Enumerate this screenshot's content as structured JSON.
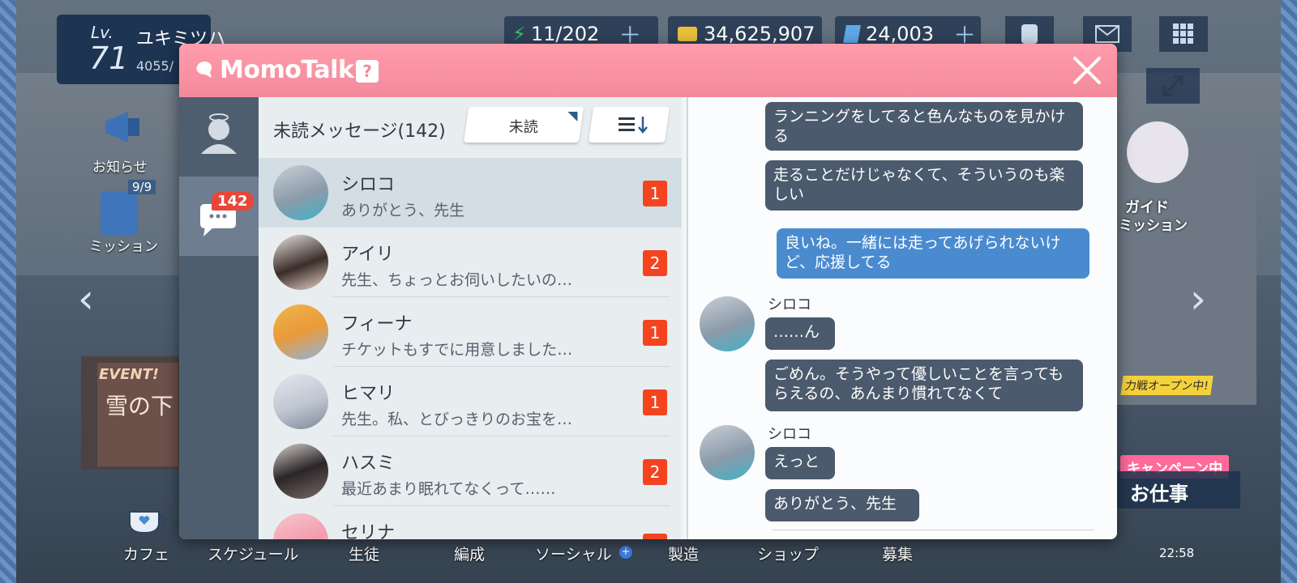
{
  "player": {
    "lv_label": "Lv.",
    "level": "71",
    "name": "ユキミツハ",
    "exp": "4055/"
  },
  "resources": [
    {
      "name": "ap",
      "value": "11/202"
    },
    {
      "name": "credits",
      "value": "34,625,907"
    },
    {
      "name": "pyroxene",
      "value": "24,003"
    }
  ],
  "side_menu": {
    "notice_label": "お知らせ",
    "mission_label": "ミッション",
    "mission_count": "9/9"
  },
  "event_banner": {
    "event_label": "EVENT!",
    "event_title": "雪の下"
  },
  "right_banner": {
    "guide_label": "ガイド",
    "mission_label": "ミッション",
    "campaign_label": "キャンペーン中",
    "work_label": "お仕事",
    "open_label": "力戦オープン中!"
  },
  "bottom_nav": [
    "カフェ",
    "スケジュール",
    "生徒",
    "編成",
    "ソーシャル",
    "製造",
    "ショップ",
    "募集"
  ],
  "clock": "22:58",
  "momotalk": {
    "title": "MomoTalk",
    "help": "?",
    "unread_badge": "142",
    "list_title": "未読メッセージ(142)",
    "filter_label": "未読",
    "conversations": [
      {
        "name": "シロコ",
        "preview": "ありがとう、先生",
        "unread": "1"
      },
      {
        "name": "アイリ",
        "preview": "先生、ちょっとお伺いしたいの…",
        "unread": "2"
      },
      {
        "name": "フィーナ",
        "preview": "チケットもすでに用意しました…",
        "unread": "1"
      },
      {
        "name": "ヒマリ",
        "preview": "先生。私、とびっきりのお宝を…",
        "unread": "1"
      },
      {
        "name": "ハスミ",
        "preview": "最近あまり眠れてなくって……",
        "unread": "2"
      },
      {
        "name": "セリナ",
        "preview": "",
        "unread": ""
      }
    ],
    "chat": {
      "m1": "ランニングをしてると色んなものを見かける",
      "m2": "走ることだけじゃなくて、そういうのも楽しい",
      "m3": "良いね。一緒には走ってあげられないけど、応援してる",
      "sender1": "シロコ",
      "m4": "……ん",
      "m5": "ごめん。そうやって優しいことを言ってもらえるの、あんまり慣れてなくて",
      "sender2": "シロコ",
      "m6": "えっと",
      "m7": "ありがとう、先生"
    }
  },
  "colors": {
    "header": "#f38a9c",
    "badge": "#f4431f",
    "student_bubble": "#4b5a6c",
    "sensei_bubble": "#4a8bd0"
  }
}
